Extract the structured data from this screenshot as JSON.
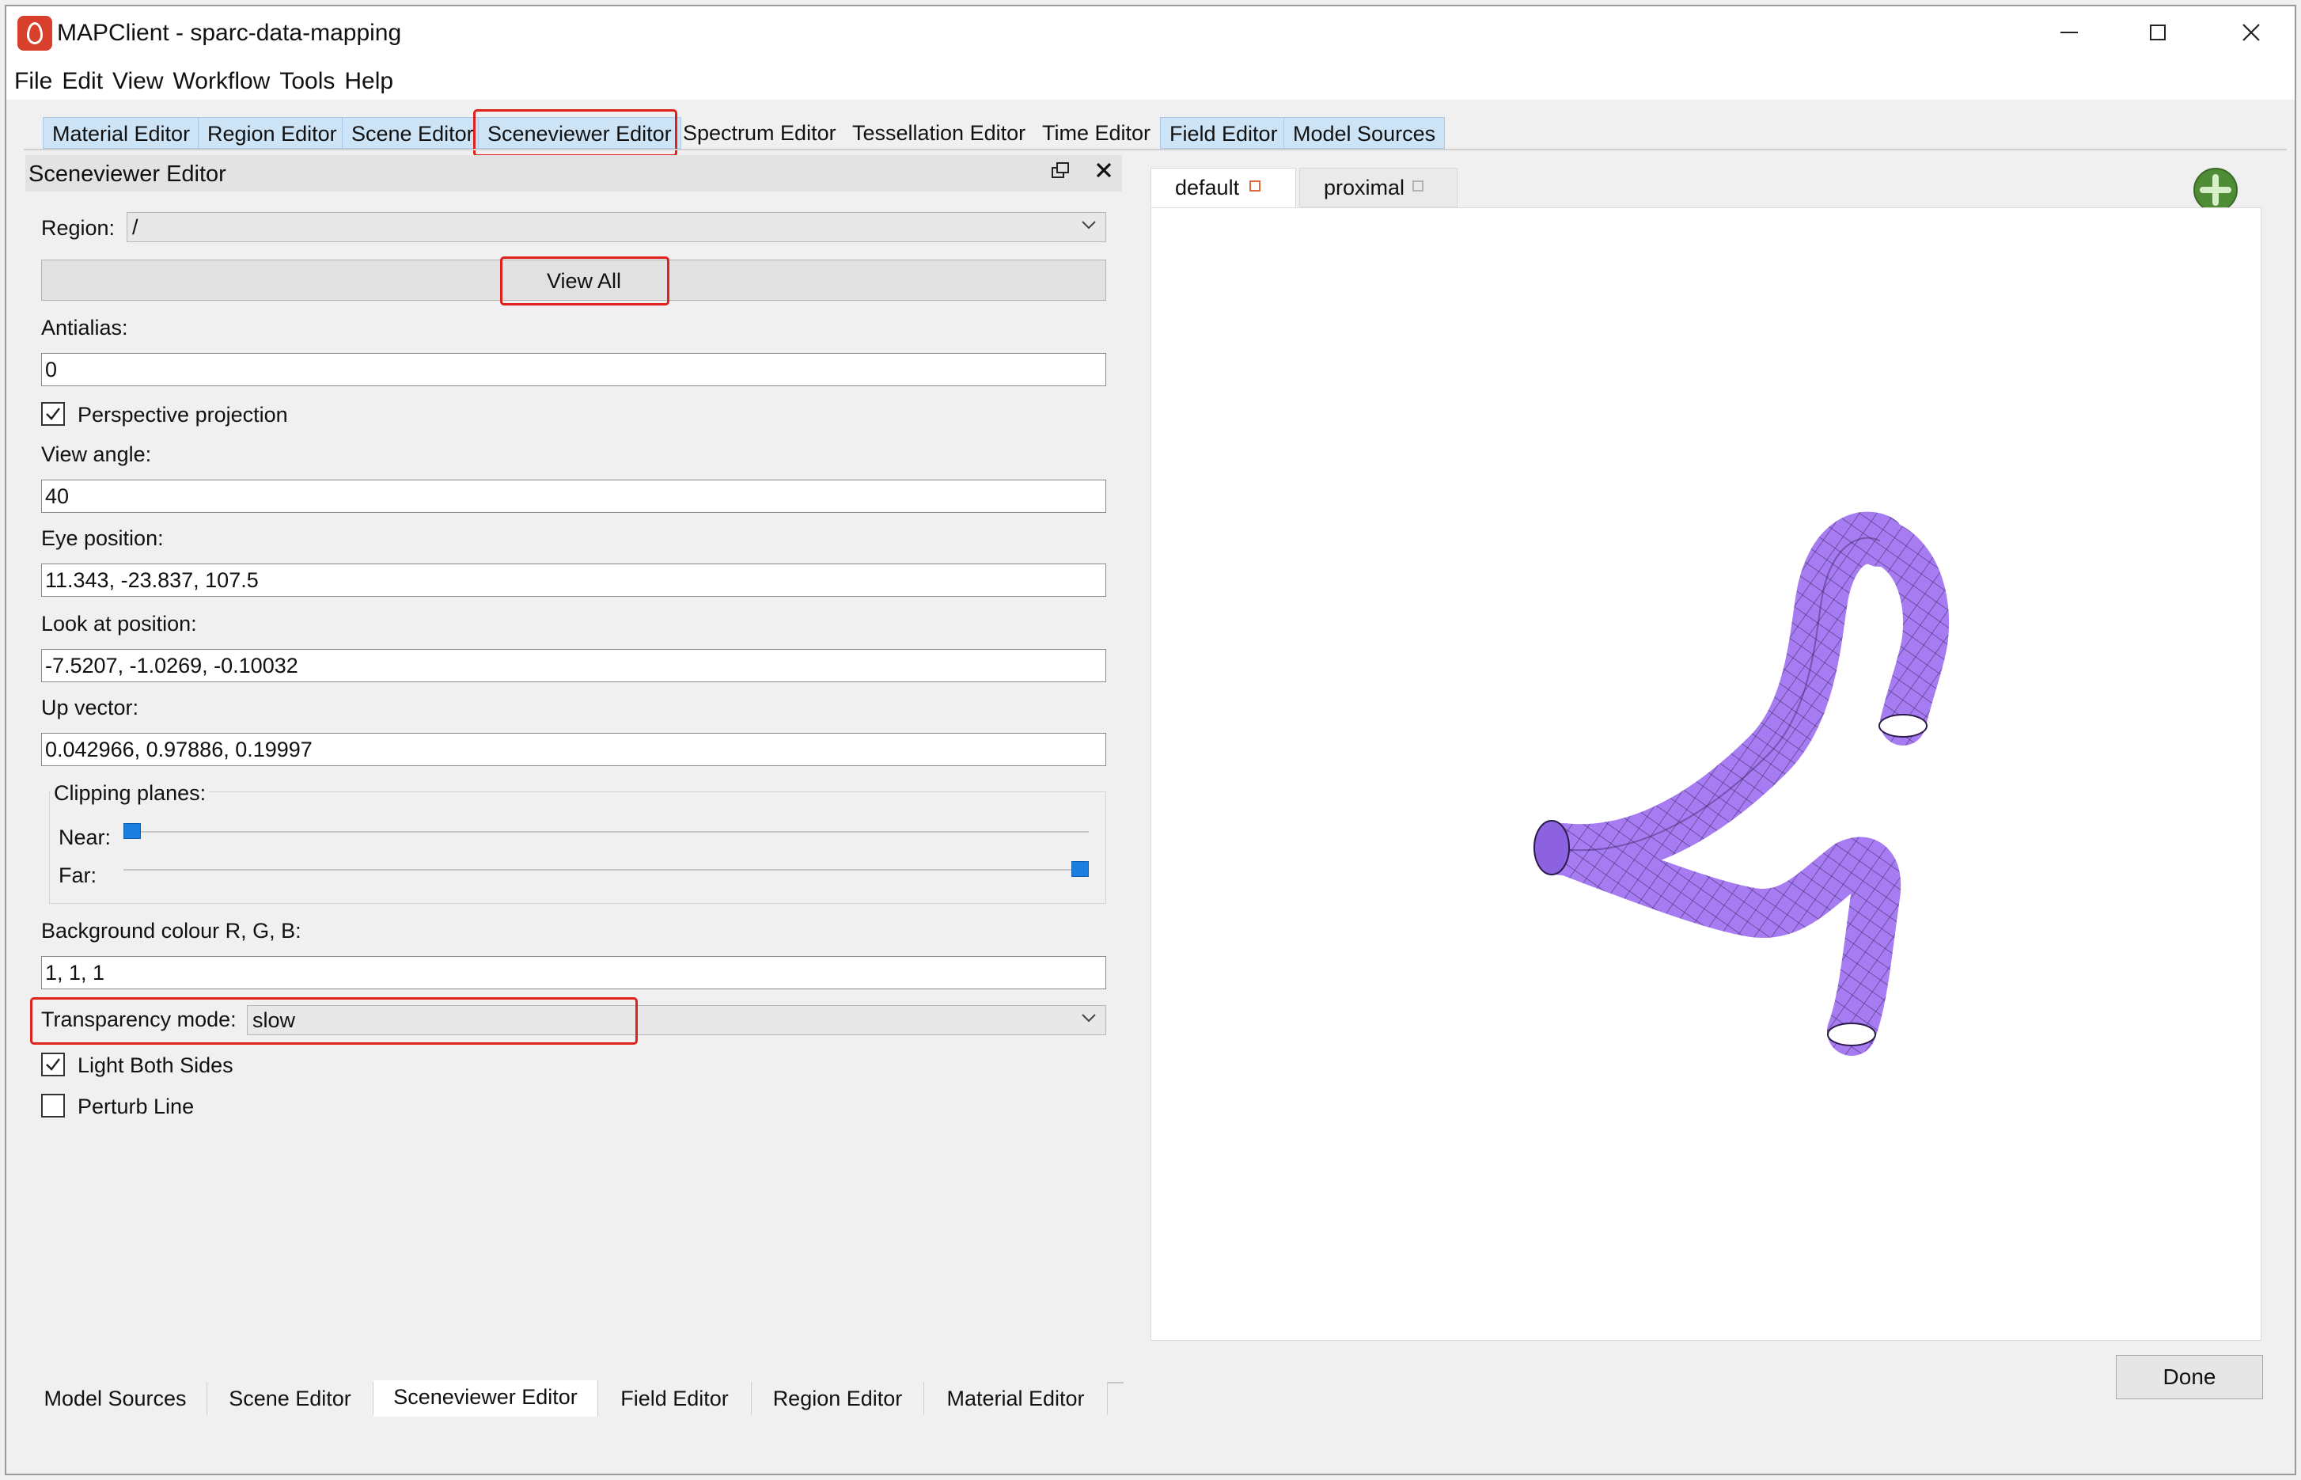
{
  "window": {
    "title": "MAPClient - sparc-data-mapping",
    "icons": {
      "app": "mapclient-app-icon",
      "minimize": "minimize-icon",
      "maximize": "maximize-icon",
      "close": "close-icon"
    }
  },
  "menubar": [
    "File",
    "Edit",
    "View",
    "Workflow",
    "Tools",
    "Help"
  ],
  "top_tabs": [
    {
      "label": "Material Editor",
      "highlighted": true
    },
    {
      "label": "Region Editor",
      "highlighted": true
    },
    {
      "label": "Scene Editor",
      "highlighted": true
    },
    {
      "label": "Sceneviewer Editor",
      "highlighted": true,
      "annotated": true
    },
    {
      "label": "Spectrum Editor",
      "highlighted": false
    },
    {
      "label": "Tessellation Editor",
      "highlighted": false
    },
    {
      "label": "Time Editor",
      "highlighted": false
    },
    {
      "label": "Field Editor",
      "highlighted": true
    },
    {
      "label": "Model Sources",
      "highlighted": true
    }
  ],
  "dock": {
    "title": "Sceneviewer Editor",
    "region_label": "Region:",
    "region_value": "/",
    "view_all_label": "View All",
    "antialias_label": "Antialias:",
    "antialias_value": "0",
    "perspective_label": "Perspective projection",
    "perspective_checked": true,
    "view_angle_label": "View angle:",
    "view_angle_value": "40",
    "eye_position_label": "Eye position:",
    "eye_position_value": "11.343, -23.837, 107.5",
    "look_at_label": "Look at position:",
    "look_at_value": "-7.5207, -1.0269, -0.10032",
    "up_vector_label": "Up vector:",
    "up_vector_value": "0.042966, 0.97886, 0.19997",
    "clipping_label": "Clipping planes:",
    "near_label": "Near:",
    "far_label": "Far:",
    "near_level": 0.0,
    "far_level": 1.0,
    "background_label": "Background colour R, G, B:",
    "background_value": "1, 1, 1",
    "transparency_label": "Transparency mode:",
    "transparency_value": "slow",
    "light_both_sides_label": "Light Both Sides",
    "light_both_sides_checked": true,
    "perturb_line_label": "Perturb Line",
    "perturb_line_checked": false
  },
  "bottom_tabs": [
    {
      "label": "Model Sources",
      "active": false
    },
    {
      "label": "Scene Editor",
      "active": false
    },
    {
      "label": "Sceneviewer Editor",
      "active": true
    },
    {
      "label": "Field Editor",
      "active": false
    },
    {
      "label": "Region Editor",
      "active": false
    },
    {
      "label": "Material Editor",
      "active": false
    }
  ],
  "view_tabs": [
    {
      "label": "default",
      "active": true
    },
    {
      "label": "proximal",
      "active": false
    }
  ],
  "model": {
    "color": "#a77cf2",
    "edge_color": "#2a1a4a"
  },
  "accent": {
    "annotation_red": "#e0201b",
    "tab_highlight": "#cde4f7",
    "slider_blue": "#1a7fe0"
  },
  "done_label": "Done"
}
